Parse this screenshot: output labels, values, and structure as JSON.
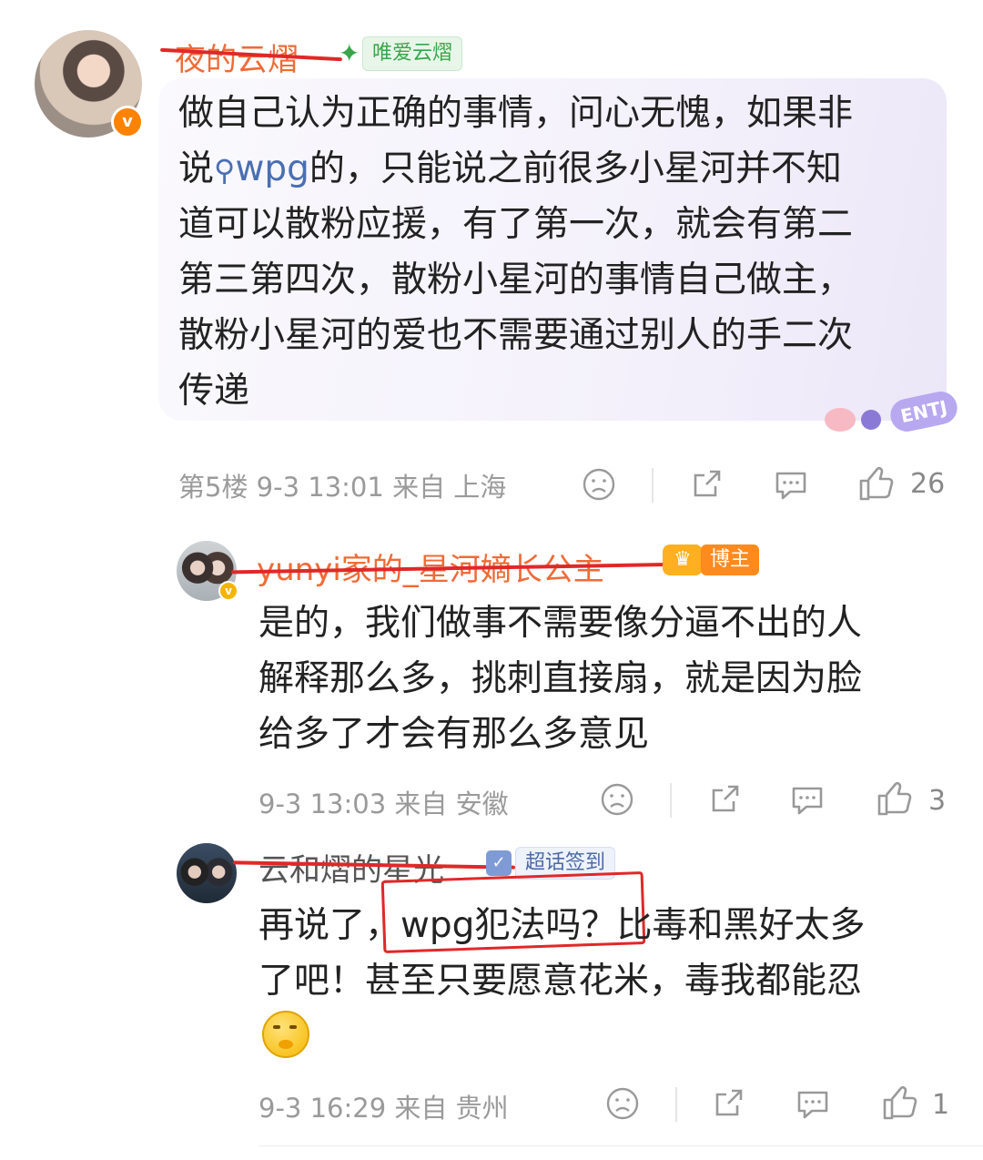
{
  "comment1": {
    "username": "夜的云熠",
    "tag": "唯爱云熠",
    "lines": [
      "做自己认为正确的事情，问心无愧，如果非",
      "的，只能说之前很多小星河并不知",
      "道可以散粉应援，有了第一次，就会有第二",
      "第三第四次，散粉小星河的事情自己做主，",
      "散粉小星河的爱也不需要通过别人的手二次",
      "传递"
    ],
    "line2_prefix": "说",
    "line2_link": "wpg",
    "sticker_text": "ENTJ",
    "floor": "第5楼",
    "time": "9-3 13:01",
    "from": "来自 上海",
    "likes": "26"
  },
  "reply1": {
    "username": "yunyi家的_星河嫡长公主",
    "tag": "博主",
    "lines": [
      "是的，我们做事不需要像分逼不出的人",
      "解释那么多，挑刺直接扇，就是因为脸",
      "给多了才会有那么多意见"
    ],
    "time": "9-3 13:03",
    "from": "来自 安徽",
    "likes": "3"
  },
  "reply2": {
    "username": "云和熠的星光",
    "tag": "超话签到",
    "line1_prefix": "再说了，",
    "line1_boxed": "wpg犯法吗？",
    "line1_suffix": "比毒和黑好太多",
    "line2": "了吧！甚至只要愿意花米，毒我都能忍",
    "time": "9-3 16:29",
    "from": "来自 贵州",
    "likes": "1"
  }
}
